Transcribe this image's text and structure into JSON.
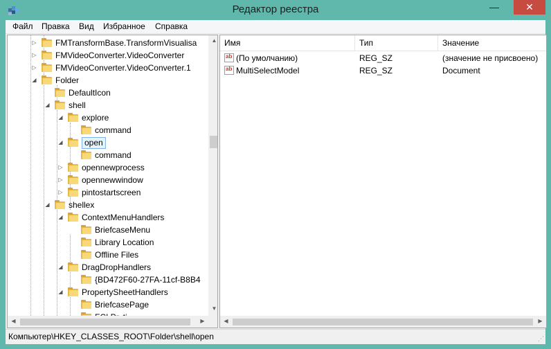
{
  "window": {
    "title": "Редактор реестра",
    "controls": {
      "minimize": "—",
      "maximize": "☐",
      "close": "✕"
    }
  },
  "menu": [
    "Файл",
    "Правка",
    "Вид",
    "Избранное",
    "Справка"
  ],
  "tree": {
    "items": [
      {
        "label": "FMTransformBase.TransformVisualisa",
        "expander": "collapsed"
      },
      {
        "label": "FMVideoConverter.VideoConverter",
        "expander": "collapsed"
      },
      {
        "label": "FMVideoConverter.VideoConverter.1",
        "expander": "collapsed"
      },
      {
        "label": "Folder",
        "expander": "expanded"
      },
      {
        "label": "DefaultIcon",
        "expander": "none"
      },
      {
        "label": "shell",
        "expander": "expanded"
      },
      {
        "label": "explore",
        "expander": "expanded"
      },
      {
        "label": "command",
        "expander": "none"
      },
      {
        "label": "open",
        "expander": "expanded",
        "selected": true
      },
      {
        "label": "command",
        "expander": "none"
      },
      {
        "label": "opennewprocess",
        "expander": "collapsed"
      },
      {
        "label": "opennewwindow",
        "expander": "collapsed"
      },
      {
        "label": "pintostartscreen",
        "expander": "collapsed"
      },
      {
        "label": "shellex",
        "expander": "expanded"
      },
      {
        "label": "ContextMenuHandlers",
        "expander": "expanded"
      },
      {
        "label": "BriefcaseMenu",
        "expander": "none"
      },
      {
        "label": "Library Location",
        "expander": "none"
      },
      {
        "label": "Offline Files",
        "expander": "none"
      },
      {
        "label": "DragDropHandlers",
        "expander": "expanded"
      },
      {
        "label": "{BD472F60-27FA-11cf-B8B4",
        "expander": "none"
      },
      {
        "label": "PropertySheetHandlers",
        "expander": "expanded"
      },
      {
        "label": "BriefcasePage",
        "expander": "none"
      },
      {
        "label": "FCI Pr..ti..",
        "expander": "none"
      }
    ]
  },
  "values": {
    "headers": {
      "name": "Имя",
      "type": "Тип",
      "data": "Значение"
    },
    "rows": [
      {
        "name": "(По умолчанию)",
        "type": "REG_SZ",
        "data": "(значение не присвоено)"
      },
      {
        "name": "MultiSelectModel",
        "type": "REG_SZ",
        "data": "Document"
      }
    ],
    "icon_text": "ab"
  },
  "status": {
    "path": "Компьютер\\HKEY_CLASSES_ROOT\\Folder\\shell\\open"
  },
  "colors": {
    "titlebar": "#5fb8ab",
    "close": "#c74b40",
    "folder": "#f8d979",
    "selection": "#e5f3fb"
  }
}
